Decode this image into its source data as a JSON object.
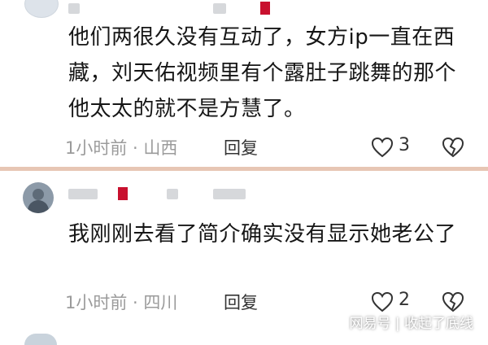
{
  "comments": [
    {
      "text": "他们两很久没有互动了，女方ip一直在西藏，刘天佑视频里有个露肚子跳舞的那个他太太的就不是方慧了。",
      "meta": "1小时前 · 山西",
      "reply_label": "回复",
      "likes": "3"
    },
    {
      "text": "我刚刚去看了简介确实没有显示她老公了",
      "meta": "1小时前 · 四川",
      "reply_label": "回复",
      "likes": "2"
    }
  ],
  "watermark": "网易号 | 收起了底线",
  "colors": {
    "divider": "#e7c6b4",
    "badge_red": "#c8102e",
    "meta_gray": "#9b9b9b"
  },
  "icons": {
    "like": "heart-outline-icon",
    "dislike": "broken-heart-icon"
  }
}
